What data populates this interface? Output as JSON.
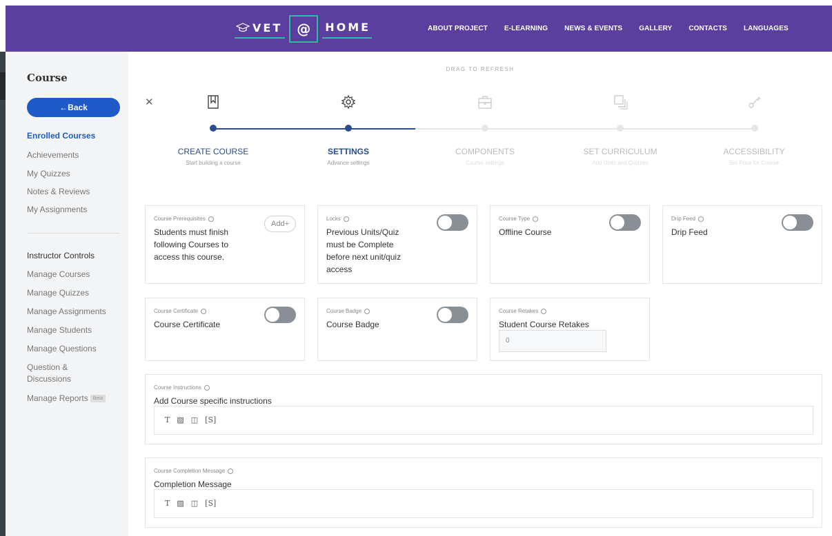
{
  "header": {
    "logo": {
      "part1": "VET",
      "at": "@",
      "part2": "HOME"
    },
    "nav": [
      "ABOUT PROJECT",
      "E-LEARNING",
      "NEWS & EVENTS",
      "GALLERY",
      "CONTACTS",
      "LANGUAGES"
    ]
  },
  "sidebar": {
    "title": "Course",
    "back_label": "←Back",
    "items": [
      {
        "label": "Enrolled Courses",
        "active": true
      },
      {
        "label": "Achievements"
      },
      {
        "label": "My Quizzes"
      },
      {
        "label": "Notes & Reviews"
      },
      {
        "label": "My Assignments"
      }
    ],
    "instructor_heading": "Instructor Controls",
    "instructor_items": [
      "Manage Courses",
      "Manage Quizzes",
      "Manage Assignments",
      "Manage Students",
      "Manage Questions",
      "Question &",
      "Discussions",
      "Manage Reports"
    ],
    "beta_label": "Beta"
  },
  "main": {
    "drag_text": "DRAG TO REFRESH",
    "steps": [
      {
        "title": "CREATE COURSE",
        "subtitle": "Start building a course",
        "icon": "bookmark-icon",
        "state": "done"
      },
      {
        "title": "SETTINGS",
        "subtitle": "Advance settings",
        "icon": "gear-icon",
        "state": "current"
      },
      {
        "title": "COMPONENTS",
        "subtitle": "Course settings",
        "icon": "briefcase-icon",
        "state": "pending"
      },
      {
        "title": "SET CURRICULUM",
        "subtitle": "Add Units and Quizzes",
        "icon": "copy-icon",
        "state": "pending"
      },
      {
        "title": "ACCESSIBILITY",
        "subtitle": "Set Price for Course",
        "icon": "key-icon",
        "state": "pending"
      }
    ],
    "cards": {
      "prerequisites": {
        "label": "Course Prerequisites",
        "value_lines": [
          "Students must finish",
          "following Courses to",
          "access this course."
        ],
        "add_label": "Add+"
      },
      "locks": {
        "label": "Locks",
        "value_lines": [
          "Previous Units/Quiz",
          "must be Complete",
          "before next unit/quiz",
          "access"
        ],
        "enabled": false
      },
      "course_type": {
        "label": "Course Type",
        "value_lines": [
          "Offline Course"
        ],
        "enabled": false
      },
      "drip_feed": {
        "label": "Drip Feed",
        "value_lines": [
          "Drip Feed"
        ],
        "enabled": false
      },
      "certificate": {
        "label": "Course Certificate",
        "value_lines": [
          "Course Certificate"
        ],
        "enabled": false
      },
      "badge": {
        "label": "Course Badge",
        "value_lines": [
          "Course Badge"
        ],
        "enabled": false
      },
      "retakes": {
        "label": "Course Retakes",
        "value_lines": [
          "Student Course Retakes"
        ],
        "input_value": "0"
      },
      "instructions": {
        "label": "Course Instructions",
        "value_lines": [
          "Add Course specific instructions"
        ]
      },
      "completion": {
        "label": "Course Completion Message",
        "value_lines": [
          "Completion Message"
        ]
      }
    },
    "editor_tools": [
      "T",
      "▨",
      "◫",
      "[S]"
    ]
  },
  "colors": {
    "header_bg": "#5a3f9e",
    "accent": "#1f5bc8",
    "stepper": "#2a4c8a",
    "toggle_off": "#8a8f96",
    "logo_accent": "#2bbfa0"
  }
}
